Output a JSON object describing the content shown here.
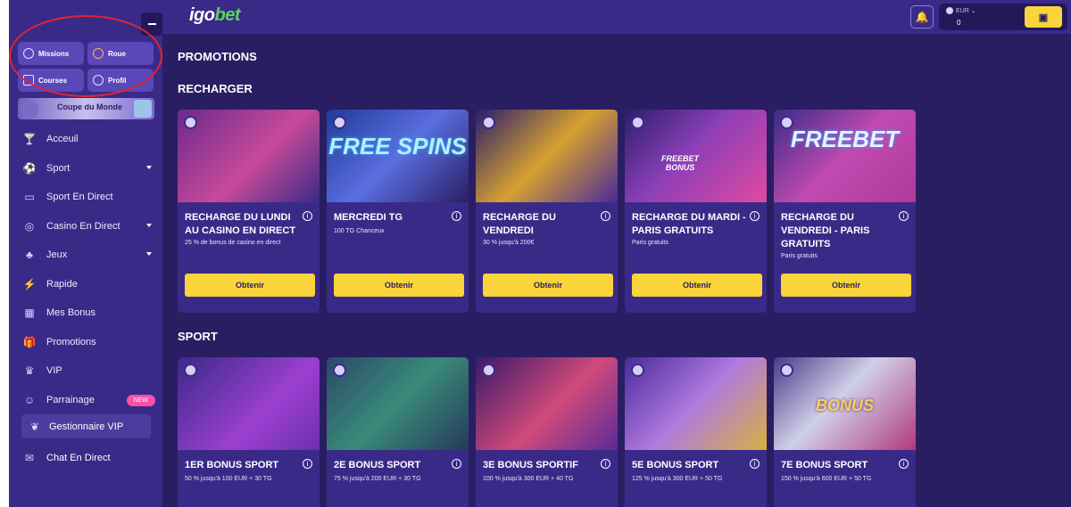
{
  "header": {
    "logo_a": "igo",
    "logo_b": "bet",
    "currency": "EUR",
    "balance": "0"
  },
  "sidebar": {
    "quick": [
      {
        "label": "Missions"
      },
      {
        "label": "Roue"
      },
      {
        "label": "Courses"
      },
      {
        "label": "Profil"
      }
    ],
    "banner": "Coupe du Monde",
    "items": [
      {
        "label": "Acceuil",
        "icon": "cocktail-icon"
      },
      {
        "label": "Sport",
        "icon": "soccer-ball-icon"
      },
      {
        "label": "Sport En Direct",
        "icon": "live-tv-icon"
      },
      {
        "label": "Casino En Direct",
        "icon": "chip-icon"
      },
      {
        "label": "Jeux",
        "icon": "slot-icon"
      },
      {
        "label": "Rapide",
        "icon": "lightning-icon"
      },
      {
        "label": "Mes Bonus",
        "icon": "bonus-icon"
      },
      {
        "label": "Promotions",
        "icon": "gift-icon"
      },
      {
        "label": "VIP",
        "icon": "crown-icon"
      },
      {
        "label": "Parrainage",
        "icon": "users-icon"
      }
    ],
    "new_badge": "NEW",
    "vip_manager": "Gestionnaire VIP",
    "chat": "Chat En Direct"
  },
  "main": {
    "title": "PROMOTIONS",
    "sections": [
      {
        "title": "RECHARGER",
        "cards": [
          {
            "title": "RECHARGE DU LUNDI AU CASINO EN DIRECT",
            "desc": "25 % de bonus de casino en direct",
            "button": "Obtenir"
          },
          {
            "title": "MERCREDI TG",
            "desc": "100 TG Chanceux",
            "button": "Obtenir",
            "art": "FREE SPINS"
          },
          {
            "title": "RECHARGE DU VENDREDI",
            "desc": "30 % jusqu'à 200€",
            "button": "Obtenir"
          },
          {
            "title": "RECHARGE DU MARDI - PARIS GRATUITS",
            "desc": "Paris gratuits",
            "button": "Obtenir",
            "art": "FREEBET BONUS"
          },
          {
            "title": "RECHARGE DU VENDREDI - PARIS GRATUITS",
            "desc": "Paris gratuits",
            "button": "Obtenir",
            "art": "FREEBET"
          }
        ]
      },
      {
        "title": "SPORT",
        "cards": [
          {
            "title": "1ER BONUS SPORT",
            "desc": "50 % jusqu'à 100 EUR + 30 TG"
          },
          {
            "title": "2E BONUS SPORT",
            "desc": "75 % jusqu'à 200 EUR + 30 TG"
          },
          {
            "title": "3E BONUS SPORTIF",
            "desc": "100 % jusqu'à 300 EUR + 40 TG"
          },
          {
            "title": "5E BONUS SPORT",
            "desc": "125 % jusqu'à 300 EUR + 50 TG"
          },
          {
            "title": "7E BONUS SPORT",
            "desc": "150 % jusqu'à 600 EUR + 50 TG",
            "art": "BONUS"
          }
        ]
      }
    ]
  },
  "colors": {
    "accent": "#f9d43a",
    "sidebar": "#3a2a88",
    "background": "#2a1e62",
    "new_badge": "#ff4fa8",
    "annotation": "#e1262c"
  }
}
